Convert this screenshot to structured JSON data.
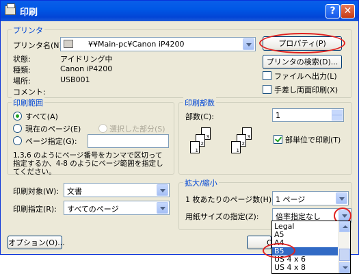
{
  "window": {
    "title": "印刷",
    "help_glyph": "?",
    "close_glyph": "✕"
  },
  "printer": {
    "group_label": "プリンタ",
    "name_label": "プリンタ名(N):",
    "name_value": "¥¥Main-pc¥Canon iP4200",
    "status_label": "状態:",
    "status_value": "アイドリング中",
    "type_label": "種類:",
    "type_value": "Canon iP4200",
    "location_label": "場所:",
    "location_value": "USB001",
    "comment_label": "コメント:",
    "properties_button": "プロパティ(P)",
    "find_button": "プリンタの検索(D)...",
    "print_to_file": "ファイルへ出力(L)",
    "manual_duplex": "手差し両面印刷(X)"
  },
  "range": {
    "group_label": "印刷範囲",
    "all": "すべて(A)",
    "current": "現在のページ(E)",
    "selection": "選択した部分(S)",
    "pages": "ページ指定(G):",
    "hint": "1,3,6 のようにページ番号をカンマで区切って指定するか、4-8 のようにページ範囲を指定してください。"
  },
  "copies": {
    "group_label": "印刷部数",
    "count_label": "部数(C):",
    "count_value": "1",
    "collate": "部単位で印刷(T)",
    "page_labels": [
      "1",
      "2",
      "3"
    ]
  },
  "print_what": {
    "label": "印刷対象(W):",
    "value": "文書"
  },
  "print_spec": {
    "label": "印刷指定(R):",
    "value": "すべてのページ"
  },
  "zoom": {
    "group_label": "拡大/縮小",
    "pages_per_sheet_label": "1 枚あたりのページ数(H):",
    "pages_per_sheet_value": "1 ページ",
    "scale_label": "用紙サイズの指定(Z):",
    "scale_value": "倍率指定なし",
    "options": [
      "Legal",
      "A5",
      "A4",
      "B5",
      "US 4 x 6",
      "US 4 x 8"
    ],
    "selected_option": "B5"
  },
  "buttons": {
    "options": "オプション(O)...",
    "ok_partial": "O"
  },
  "annotation_color": "#e0201f"
}
